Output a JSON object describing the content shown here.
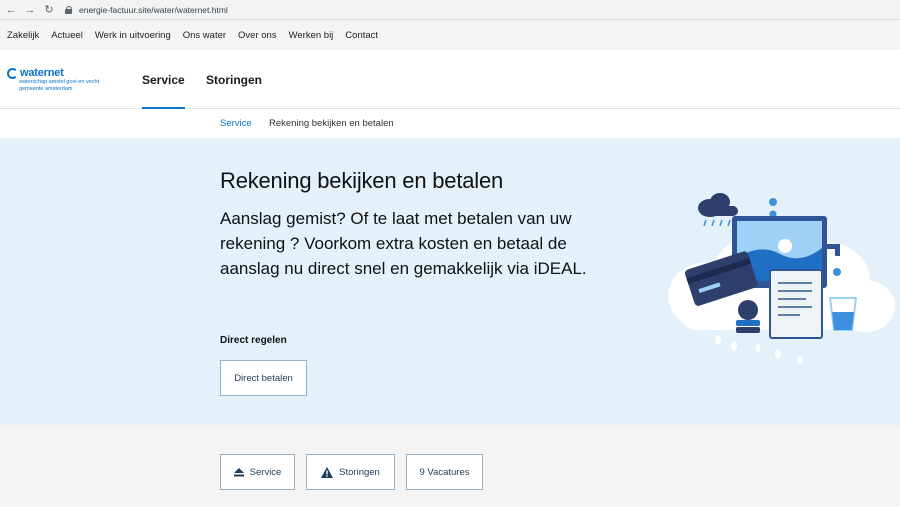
{
  "browser": {
    "url": "energie-factuur.site/water/waternet.html"
  },
  "topnav": {
    "items": [
      "Zakelijk",
      "Actueel",
      "Werk in uitvoering",
      "Ons water",
      "Over ons",
      "Werken bij",
      "Contact"
    ]
  },
  "logo": {
    "name": "waternet",
    "subtitle": "waterschap amstel gooi en vecht gemeente amsterdam"
  },
  "mainnav": {
    "items": [
      "Service",
      "Storingen"
    ],
    "active": "Service"
  },
  "breadcrumb": {
    "parent": "Service",
    "current": "Rekening bekijken en betalen"
  },
  "hero": {
    "title": "Rekening bekijken en betalen",
    "text": "Aanslag gemist? Of te laat met betalen van uw rekening ? Voorkom extra kosten en betaal de aanslag nu direct snel en gemakkelijk via iDEAL.",
    "direct_label": "Direct regelen",
    "direct_button": "Direct betalen"
  },
  "tiles": {
    "service": "Service",
    "storingen": "Storingen",
    "vacatures": "9 Vacatures"
  },
  "colors": {
    "accent": "#0a73c8",
    "hero_bg": "#e4f1fb",
    "button_text": "#1e3c5a"
  }
}
